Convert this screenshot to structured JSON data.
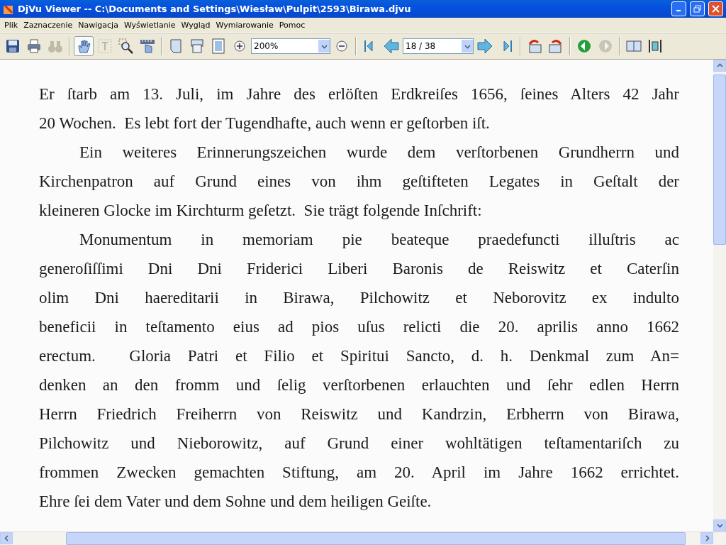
{
  "window": {
    "title": "DjVu Viewer -- C:\\Documents and Settings\\Wiesław\\Pulpit\\2593\\Birawa.djvu"
  },
  "menu": [
    "Plik",
    "Zaznaczenie",
    "Nawigacja",
    "Wyświetlanie",
    "Wygląd",
    "Wymiarowanie",
    "Pomoc"
  ],
  "toolbar": [
    [
      {
        "kind": "save",
        "disabled": false
      },
      {
        "kind": "print",
        "disabled": false
      },
      {
        "kind": "find",
        "disabled": true
      }
    ],
    [
      {
        "kind": "hand",
        "disabled": false,
        "selected": true
      },
      {
        "kind": "text",
        "disabled": true,
        "selected": false
      },
      {
        "kind": "zoomrect",
        "disabled": false,
        "selected": false
      },
      {
        "kind": "ruler",
        "disabled": false,
        "selected": false
      }
    ],
    [
      {
        "kind": "page",
        "disabled": false
      },
      {
        "kind": "pages",
        "disabled": false
      },
      {
        "kind": "fitpage",
        "disabled": false
      },
      {
        "kind": "zoomin",
        "disabled": false
      },
      {
        "kind": "combo",
        "value": "200%"
      },
      {
        "kind": "zoomout",
        "disabled": false
      }
    ],
    [
      {
        "kind": "first",
        "disabled": false
      },
      {
        "kind": "prev",
        "disabled": false
      },
      {
        "kind": "combo",
        "value": "18 / 38"
      },
      {
        "kind": "next",
        "disabled": false
      },
      {
        "kind": "last",
        "disabled": false
      }
    ],
    [
      {
        "kind": "rotleft",
        "disabled": false
      },
      {
        "kind": "rotright",
        "disabled": false
      }
    ],
    [
      {
        "kind": "back",
        "disabled": false
      },
      {
        "kind": "forward",
        "disabled": true
      }
    ],
    [
      {
        "kind": "layout",
        "disabled": false
      },
      {
        "kind": "fitwidth",
        "disabled": false
      }
    ]
  ],
  "document": {
    "paragraphs": [
      {
        "indent": false,
        "lines": [
          "Er ſtarb am 13. Juli, im Jahre des erlöſten Erdkreiſes 1656, ſeines Alters 42 Jahr",
          "20 Wochen.  Es lebt fort der Tugendhafte, auch wenn er geſtorben iſt."
        ]
      },
      {
        "indent": true,
        "lines": [
          "Ein weiteres Erinnerungszeichen wurde dem verſtorbenen Grundherrn und",
          "Kirchenpatron auf Grund eines von ihm geſtifteten Legates in Geſtalt der",
          "kleineren Glocke im Kirchturm geſetzt.  Sie trägt folgende Inſchrift:"
        ]
      },
      {
        "indent": true,
        "lines": [
          "Monumentum in memoriam pie beateque praedefuncti illuſtris ac",
          "generoſiſſimi Dni Dni Friderici Liberi Baronis de Reiswitz et Caterſin",
          "olim Dni haereditarii in Birawa, Pilchowitz et Neborovitz ex indulto",
          "beneficii in teſtamento eius ad pios uſus relicti die 20. aprilis anno 1662",
          "erectum.  Gloria Patri et Filio et Spiritui Sancto, d. h. Denkmal zum An=",
          "denken an den fromm und ſelig verſtorbenen erlauchten und ſehr edlen Herrn",
          "Herrn Friedrich Freiherrn von Reiswitz und Kandrzin, Erbherrn von Birawa,",
          "Pilchowitz und Nieborowitz, auf Grund einer wohltätigen teſtamentariſch zu",
          "frommen Zwecken gemachten Stiftung, am 20. April im Jahre 1662 errichtet.",
          "Ehre ſei dem Vater und dem Sohne und dem heiligen Geiſte."
        ]
      }
    ]
  }
}
